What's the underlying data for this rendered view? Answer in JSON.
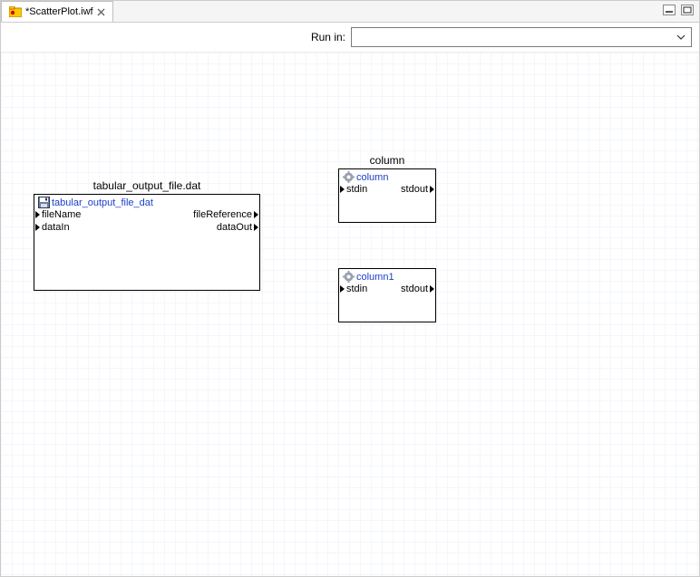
{
  "tab": {
    "label": "*ScatterPlot.iwf"
  },
  "toolbar": {
    "run_in_label": "Run in:",
    "dropdown_value": ""
  },
  "nodes": {
    "tabular": {
      "group_title": "tabular_output_file.dat",
      "name": "tabular_output_file_dat",
      "ports": {
        "fileName": "fileName",
        "fileReference": "fileReference",
        "dataIn": "dataIn",
        "dataOut": "dataOut"
      }
    },
    "column_group_title": "column",
    "col0": {
      "name": "column",
      "ports": {
        "stdin": "stdin",
        "stdout": "stdout"
      }
    },
    "col1": {
      "name": "column1",
      "ports": {
        "stdin": "stdin",
        "stdout": "stdout"
      }
    }
  }
}
